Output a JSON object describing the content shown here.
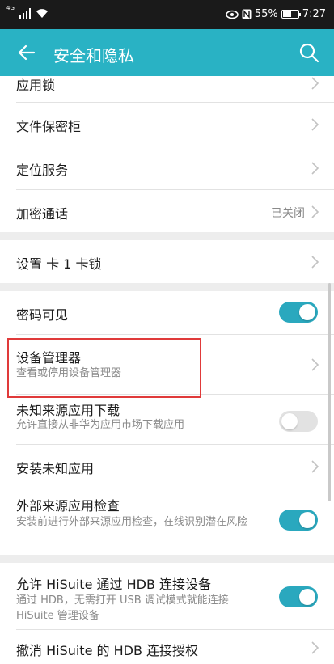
{
  "status_bar": {
    "signal_label": "4G",
    "battery_percent": "55%",
    "battery_level": 0.55,
    "time": "7:27",
    "icons": [
      "signal-icon",
      "wifi-icon",
      "eye-comfort-icon",
      "nfc-icon",
      "battery-icon"
    ]
  },
  "app_bar": {
    "title": "安全和隐私",
    "color": "#29b2c4"
  },
  "groups": {
    "g1": {
      "app_lock": "应用锁",
      "file_safe": "文件保密柜",
      "location": "定位服务",
      "encrypted_call": "加密通话",
      "encrypted_call_value": "已关闭"
    },
    "g2": {
      "sim_lock": "设置 卡 1 卡锁"
    },
    "g3": {
      "password_visible": "密码可见",
      "password_visible_on": true,
      "device_admin": "设备管理器",
      "device_admin_sub": "查看或停用设备管理器",
      "unknown_sources": "未知来源应用下载",
      "unknown_sources_sub": "允许直接从非华为应用市场下载应用",
      "unknown_sources_on": false,
      "install_unknown": "安装未知应用",
      "external_check": "外部来源应用检查",
      "external_check_sub": "安装前进行外部来源应用检查，在线识别潜在风险",
      "external_check_on": true
    },
    "g4": {
      "hisuite_hdb": "允许 HiSuite 通过 HDB 连接设备",
      "hisuite_hdb_sub": "通过 HDB，无需打开 USB 调试模式就能连接 HiSuite 管理设备",
      "hisuite_hdb_on": true,
      "revoke_hdb": "撤消 HiSuite 的 HDB 连接授权"
    }
  },
  "colors": {
    "accent": "#29b2c4",
    "toggle_on": "#2aa8be",
    "highlight_border": "#e03a3a"
  }
}
